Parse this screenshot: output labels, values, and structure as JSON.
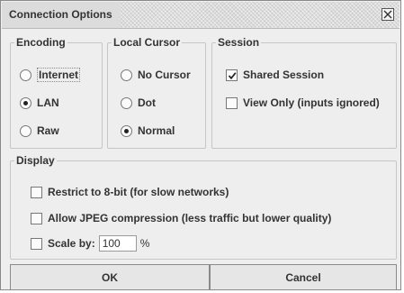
{
  "window": {
    "title": "Connection Options"
  },
  "encoding": {
    "label": "Encoding",
    "options": [
      "Internet",
      "LAN",
      "Raw"
    ],
    "selected": "LAN"
  },
  "cursor": {
    "label": "Local Cursor",
    "options": [
      "No Cursor",
      "Dot",
      "Normal"
    ],
    "selected": "Normal"
  },
  "session": {
    "label": "Session",
    "shared_session": {
      "label": "Shared Session",
      "checked": true
    },
    "view_only": {
      "label": "View Only (inputs ignored)",
      "checked": false
    }
  },
  "display": {
    "label": "Display",
    "restrict_8bit": {
      "label": "Restrict to 8-bit (for slow networks)",
      "checked": false
    },
    "allow_jpeg": {
      "label": "Allow JPEG compression (less traffic but lower quality)",
      "checked": false
    },
    "scale": {
      "label": "Scale by:",
      "checked": false,
      "value": "100",
      "unit": "%"
    }
  },
  "buttons": {
    "ok": "OK",
    "cancel": "Cancel"
  }
}
